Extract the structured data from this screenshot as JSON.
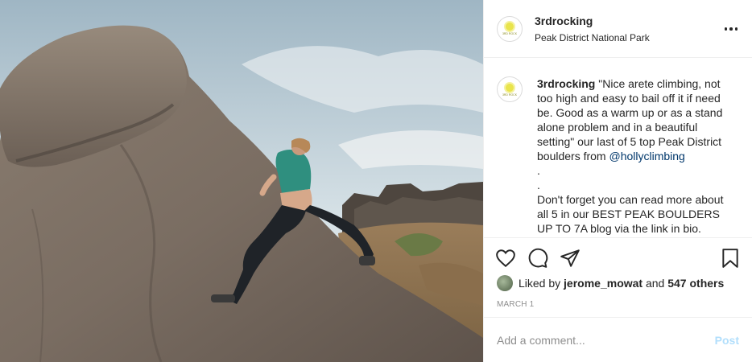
{
  "post": {
    "image_alt": "Climber on a gritstone boulder in the Peak District",
    "header": {
      "username": "3rdrocking",
      "location": "Peak District National Park",
      "avatar_icon": "3rdrocking-logo-avatar",
      "more_icon": "more-options-icon"
    },
    "caption": {
      "username": "3rdrocking",
      "text_part1": "\"Nice arete climbing, not too high and easy to bail off it if need be. Good as a warm up or as a stand alone problem and in a beautiful setting\" our last of 5 top Peak District boulders from ",
      "mention": "@hollyclimbing",
      "dot1": ".",
      "dot2": ".",
      "text_part2": "Don't forget you can read more about all 5 in our BEST PEAK BOULDERS UP TO 7A blog via the link in bio."
    },
    "actions": {
      "like_icon": "heart-icon",
      "comment_icon": "comment-icon",
      "share_icon": "share-icon",
      "save_icon": "bookmark-icon"
    },
    "likes": {
      "prefix": "Liked by ",
      "user": "jerome_mowat",
      "and": " and ",
      "others": "547 others"
    },
    "date": "MARCH 1",
    "comment_box": {
      "placeholder": "Add a comment...",
      "post_label": "Post"
    },
    "colors": {
      "accent_disabled": "#b2dffc",
      "mention": "#00376b",
      "meta": "#8e8e8e"
    }
  }
}
